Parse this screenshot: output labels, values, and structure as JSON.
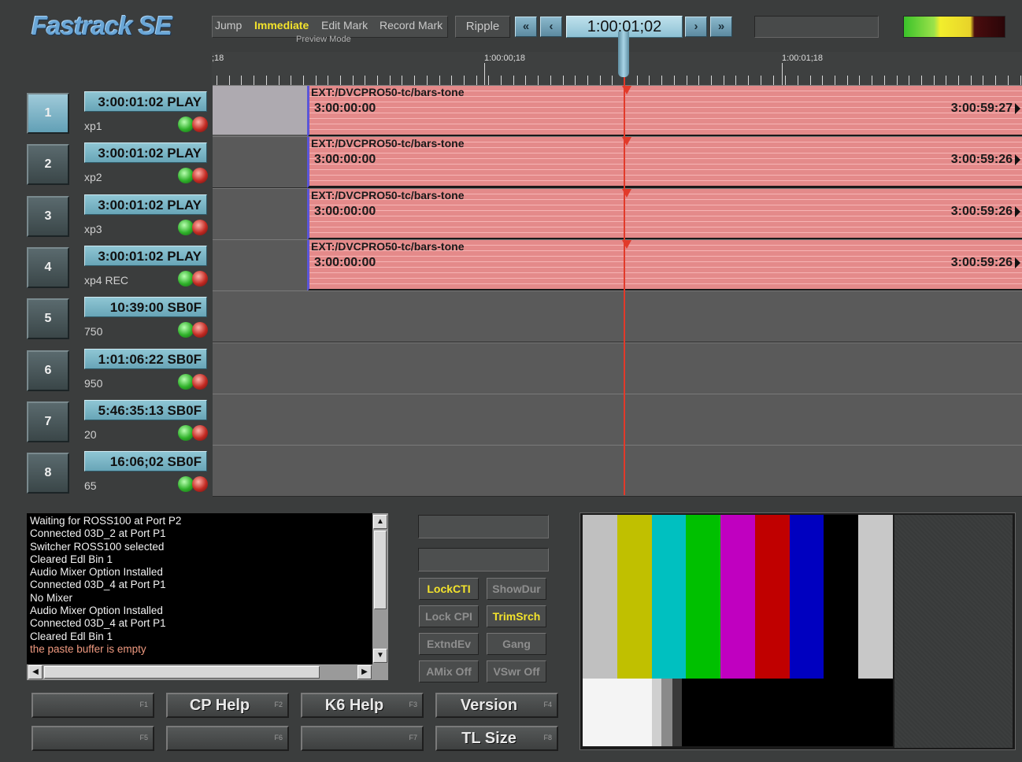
{
  "app": {
    "title": "Fastrack SE"
  },
  "modes": {
    "items": [
      {
        "label": "Jump",
        "active": false
      },
      {
        "label": "Immediate",
        "active": true
      },
      {
        "label": "Edit Mark",
        "active": false
      },
      {
        "label": "Record Mark",
        "active": false
      }
    ],
    "caption": "Preview Mode",
    "ripple": "Ripple"
  },
  "transport": {
    "timecode": "1:00:01;02",
    "buttons": [
      "rewind-fast",
      "step-back",
      "step-forward",
      "forward-fast"
    ]
  },
  "ruler": {
    "labels": [
      ";18",
      "1:00:00;18",
      "1:00:01;18"
    ]
  },
  "channels": [
    {
      "num": "1",
      "status": "3:00:01:02 PLAY",
      "sub": "xp1",
      "selected": true
    },
    {
      "num": "2",
      "status": "3:00:01:02 PLAY",
      "sub": "xp2",
      "selected": false
    },
    {
      "num": "3",
      "status": "3:00:01:02 PLAY",
      "sub": "xp3",
      "selected": false
    },
    {
      "num": "4",
      "status": "3:00:01:02 PLAY",
      "sub": "xp4 REC",
      "selected": false
    },
    {
      "num": "5",
      "status": "10:39:00 SB0F",
      "sub": "750",
      "selected": false
    },
    {
      "num": "6",
      "status": "1:01:06:22 SB0F",
      "sub": "950",
      "selected": false
    },
    {
      "num": "7",
      "status": "5:46:35:13 SB0F",
      "sub": "20",
      "selected": false
    },
    {
      "num": "8",
      "status": "16:06;02 SB0F",
      "sub": "65",
      "selected": false
    }
  ],
  "clips": [
    {
      "title": "EXT:/DVCPRO50-tc/bars-tone",
      "in": "3:00:00:00",
      "out": "3:00:59:27"
    },
    {
      "title": "EXT:/DVCPRO50-tc/bars-tone",
      "in": "3:00:00:00",
      "out": "3:00:59:26"
    },
    {
      "title": "EXT:/DVCPRO50-tc/bars-tone",
      "in": "3:00:00:00",
      "out": "3:00:59:26"
    },
    {
      "title": "EXT:/DVCPRO50-tc/bars-tone",
      "in": "3:00:00:00",
      "out": "3:00:59:26"
    }
  ],
  "log": {
    "lines": [
      "Waiting for ROSS100 at Port P2",
      "Connected 03D_2 at Port P1",
      "Switcher ROSS100 selected",
      "Cleared Edl Bin 1",
      "Audio Mixer Option Installed",
      "Connected 03D_4 at Port P1",
      "No Mixer",
      "Audio Mixer Option Installed",
      "Connected 03D_4 at Port P1",
      "Cleared Edl Bin 1"
    ],
    "warning": "the paste buffer is empty"
  },
  "options": [
    {
      "label": "LockCTI",
      "on": true
    },
    {
      "label": "ShowDur",
      "on": false
    },
    {
      "label": "Lock CPI",
      "on": false
    },
    {
      "label": "TrimSrch",
      "on": true
    },
    {
      "label": "ExtndEv",
      "on": false
    },
    {
      "label": "Gang",
      "on": false
    },
    {
      "label": "AMix Off",
      "on": false
    },
    {
      "label": "VSwr Off",
      "on": false
    }
  ],
  "fkeys": [
    {
      "label": "",
      "fn": "F1"
    },
    {
      "label": "CP Help",
      "fn": "F2"
    },
    {
      "label": "K6 Help",
      "fn": "F3"
    },
    {
      "label": "Version",
      "fn": "F4"
    },
    {
      "label": "",
      "fn": "F5"
    },
    {
      "label": "",
      "fn": "F6"
    },
    {
      "label": "",
      "fn": "F7"
    },
    {
      "label": "TL Size",
      "fn": "F8"
    }
  ],
  "colors": {
    "playhead": "#e23a2a",
    "clip": "#e48a8a",
    "active_mode": "#f3e32c",
    "status_bg": "#8fc6d4",
    "color_bars": [
      "#c0c0c0",
      "#c0c000",
      "#00c0c0",
      "#00c000",
      "#c000c0",
      "#c00000",
      "#0000c0",
      "#000000",
      "#c8c8c8"
    ]
  }
}
